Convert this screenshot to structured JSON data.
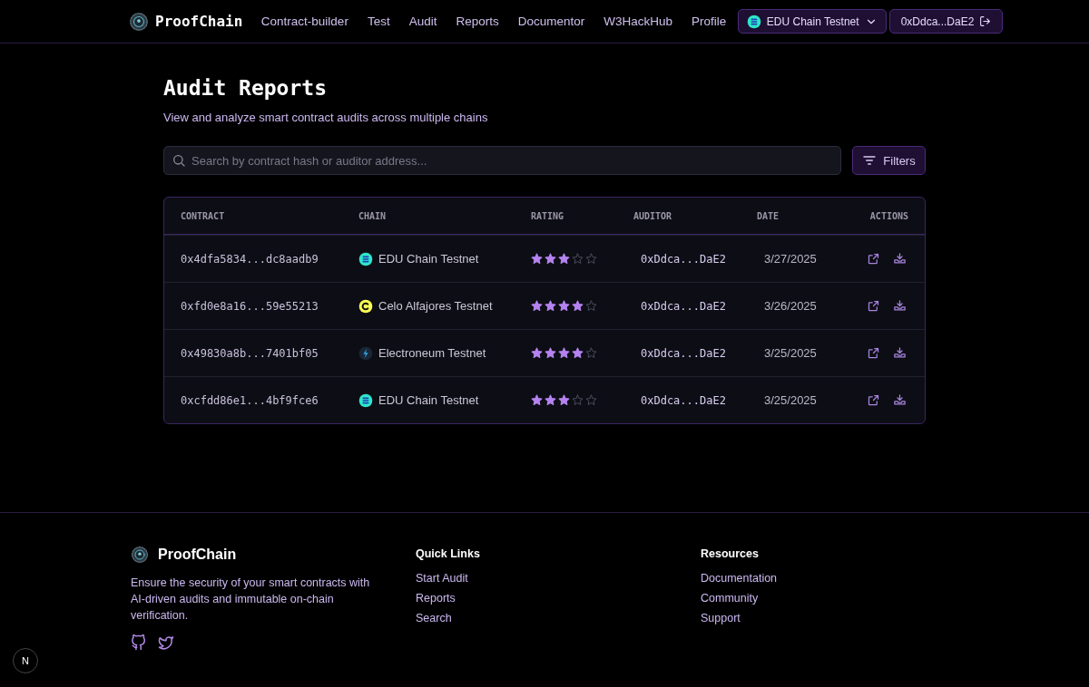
{
  "nav": {
    "brand": "ProofChain",
    "links": [
      "Contract-builder",
      "Test",
      "Audit",
      "Reports",
      "Documentor",
      "W3HackHub",
      "Profile"
    ],
    "network": {
      "label": "EDU Chain Testnet",
      "kind": "edu"
    },
    "wallet": "0xDdca...DaE2"
  },
  "header": {
    "title": "Audit Reports",
    "subtitle": "View and analyze smart contract audits across multiple chains"
  },
  "search": {
    "placeholder": "Search by contract hash or auditor address..."
  },
  "filters_button": "Filters",
  "table": {
    "columns": [
      "CONTRACT",
      "CHAIN",
      "RATING",
      "AUDITOR",
      "DATE",
      "ACTIONS"
    ],
    "rows": [
      {
        "contract": "0x4dfa5834...dc8aadb9",
        "chain": {
          "name": "EDU Chain Testnet",
          "kind": "edu"
        },
        "stars": 3,
        "auditor": "0xDdca...DaE2",
        "date": "3/27/2025"
      },
      {
        "contract": "0xfd0e8a16...59e55213",
        "chain": {
          "name": "Celo Alfajores Testnet",
          "kind": "celo"
        },
        "stars": 4,
        "auditor": "0xDdca...DaE2",
        "date": "3/26/2025"
      },
      {
        "contract": "0x49830a8b...7401bf05",
        "chain": {
          "name": "Electroneum Testnet",
          "kind": "electroneum"
        },
        "stars": 4,
        "auditor": "0xDdca...DaE2",
        "date": "3/25/2025"
      },
      {
        "contract": "0xcfdd86e1...4bf9fce6",
        "chain": {
          "name": "EDU Chain Testnet",
          "kind": "edu"
        },
        "stars": 3,
        "auditor": "0xDdca...DaE2",
        "date": "3/25/2025"
      }
    ]
  },
  "footer": {
    "brand": "ProofChain",
    "description": "Ensure the security of your smart contracts with AI-driven audits and immutable on-chain verification.",
    "columns": [
      {
        "title": "Quick Links",
        "links": [
          "Start Audit",
          "Reports",
          "Search"
        ]
      },
      {
        "title": "Resources",
        "links": [
          "Documentation",
          "Community",
          "Support"
        ]
      }
    ]
  },
  "dev_badge": "N"
}
